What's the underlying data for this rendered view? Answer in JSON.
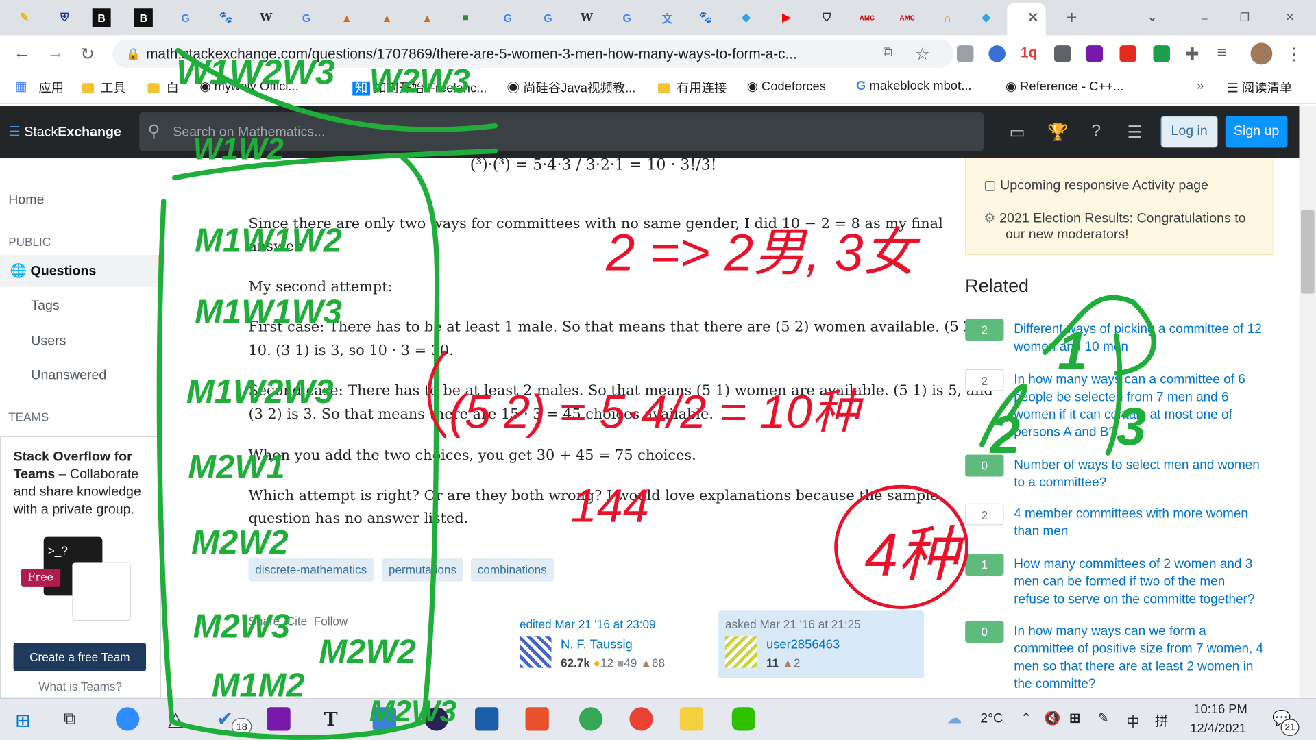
{
  "browser": {
    "url": "math.stackexchange.com/questions/1707869/there-are-5-women-3-men-how-many-ways-to-form-a-c...",
    "bookmarks": [
      "应用",
      "工具",
      "白",
      "mywely Offici...",
      "如何开始 Freelanc...",
      "尚硅谷Java视频教...",
      "有用连接",
      "Codeforces",
      "makeblock mbot...",
      "Reference - C++...",
      "阅读清单"
    ]
  },
  "se_header": {
    "logo_a": "Stack",
    "logo_b": "Exchange",
    "search_placeholder": "Search on Mathematics...",
    "login": "Log in",
    "signup": "Sign up"
  },
  "leftnav": {
    "home": "Home",
    "public": "PUBLIC",
    "questions": "Questions",
    "tags": "Tags",
    "users": "Users",
    "unanswered": "Unanswered",
    "teams": "TEAMS",
    "teams_title": "Stack Overflow for Teams",
    "teams_text1": " – Collaborate",
    "teams_text2": "and share knowledge",
    "teams_text3": "with a private group.",
    "free": "Free",
    "create_team": "Create a free Team",
    "what_is": "What is Teams?"
  },
  "question": {
    "p1a": "Since there are only two ways for committees with no same gender, I did 10 − 2 = 8 as my final",
    "p1b": "answer.",
    "p2": "My second attempt:",
    "p3a": "First case: There has to be at least 1 male. So that means that there are (5 2) women available. (5 2) is",
    "p3b": "10. (3 1) is 3, so 10 · 3 = 30.",
    "p4a": "Second case: There has to be at least 2 males. So that means (5 1) women are available. (5 1) is 5, and",
    "p4b": "(3 2) is 3. So that means there are 15 · 3 = 45 choices available.",
    "p5": "When you add the two choices, you get 30 + 45 = 75 choices.",
    "p6a": "Which attempt is right? Or are they both wrong? I would love explanations because the sample",
    "p6b": "question has no answer listed.",
    "tags": [
      "discrete-mathematics",
      "permutations",
      "combinations"
    ],
    "share": "Share",
    "cite": "Cite",
    "follow": "Follow",
    "edited": "edited Mar 21 '16 at 23:09",
    "editor": "N. F. Taussig",
    "editor_rep": "62.7k",
    "editor_gold": "12",
    "editor_silver": "49",
    "editor_bronze": "68",
    "asked": "asked Mar 21 '16 at 21:25",
    "asker": "user2856463",
    "asker_rep": "11",
    "asker_bronze": "2"
  },
  "sidebar": {
    "notice1": "Upcoming responsive Activity page",
    "notice2a": "2021 Election Results: Congratulations to",
    "notice2b": "our new moderators!",
    "related_title": "Related",
    "related": [
      {
        "count": "2",
        "answered": true,
        "lines": [
          "Different ways of picking a committee of 12",
          "women and 10 men"
        ]
      },
      {
        "count": "2",
        "answered": false,
        "lines": [
          "In how many ways can a committee of 6",
          "people be selected from 7 men and 6",
          "women if it can contain at most one of",
          "persons A and B?"
        ]
      },
      {
        "count": "0",
        "answered": true,
        "lines": [
          "Number of ways to select men and women",
          "to a committee?"
        ]
      },
      {
        "count": "2",
        "answered": false,
        "lines": [
          "4 member committees with more women",
          "than men"
        ]
      },
      {
        "count": "1",
        "answered": true,
        "lines": [
          "How many committees of 2 women and 3",
          "men can be formed if two of the men",
          "refuse to serve on the committe together?"
        ]
      },
      {
        "count": "0",
        "answered": true,
        "lines": [
          "In how many ways can we form a",
          "committee of positive size from 7 women, 4",
          "men so that there are at least 2 women in",
          "the committe?"
        ]
      }
    ]
  },
  "taskbar": {
    "temp": "2°C",
    "ime": "中",
    "time": "10:16 PM",
    "date": "12/4/2021",
    "badge1": "18",
    "badge2": "21"
  },
  "ink_green": [
    "W1W2W3",
    "W2W3",
    "W1W2",
    "M1W1W2",
    "M1W1W3",
    "M1W2W3",
    "M2W1",
    "M2W2",
    "M2W3",
    "M1M2",
    "M2W2",
    "M2W3",
    "1",
    "2",
    "3"
  ],
  "ink_red": [
    "2 => 2男, 3女",
    "(5 2) = 5·4/2 = 10种",
    "144",
    "4种"
  ],
  "colors": {
    "accent": "#f48225",
    "link": "#0074cc",
    "green_ink": "#1fae3a",
    "red_ink": "#e8132b"
  }
}
